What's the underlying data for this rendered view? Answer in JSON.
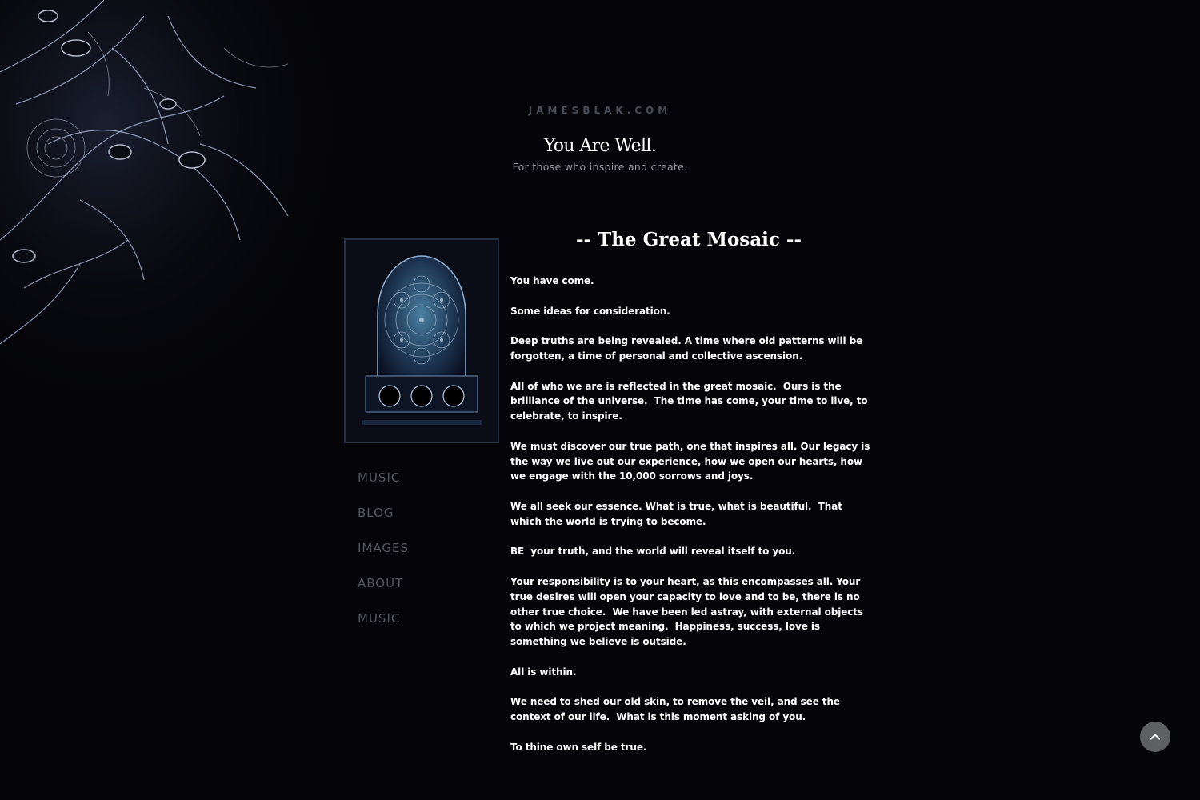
{
  "site": {
    "name": "JAMESBLAK.COM",
    "title": "You Are Well.",
    "tagline": "For those who inspire and create."
  },
  "nav": {
    "items": [
      {
        "label": "MUSIC"
      },
      {
        "label": "BLOG"
      },
      {
        "label": "IMAGES"
      },
      {
        "label": "ABOUT"
      },
      {
        "label": "MUSIC"
      }
    ]
  },
  "post": {
    "title": "-- The Great Mosaic --",
    "paragraphs": [
      "You have come.",
      "Some ideas for consideration.",
      "Deep truths are being revealed. A time where old patterns will be forgotten, a time of personal and collective ascension.",
      "All of who we are is reflected in the great mosaic.  Ours is the brilliance of the universe.  The time has come, your time to live, to celebrate, to inspire.",
      "We must discover our true path, one that inspires all. Our legacy is the way we live out our experience, how we open our hearts, how we engage with the 10,000 sorrows and joys.",
      "We all seek our essence. What is true, what is beautiful.  That which the world is trying to become.",
      "BE  your truth, and the world will reveal itself to you.",
      "Your responsibility is to your heart, as this encompasses all. Your true desires will open your capacity to love and to be, there is no other true choice.  We have been led astray, with external objects to which we project meaning.  Happiness, success, love is something we believe is outside.",
      "All is within.",
      "We need to shed our old skin, to remove the veil, and see the context of our life.  What is this moment asking of you.",
      "To thine own self be true."
    ]
  },
  "icons": {
    "scroll_top": "chevron-up-icon",
    "background": "fractal-artwork",
    "post_image": "mosaic-archway-artwork"
  },
  "colors": {
    "background": "#050509",
    "nav_text": "#55575e",
    "scroll_button": "#5d5f63"
  }
}
